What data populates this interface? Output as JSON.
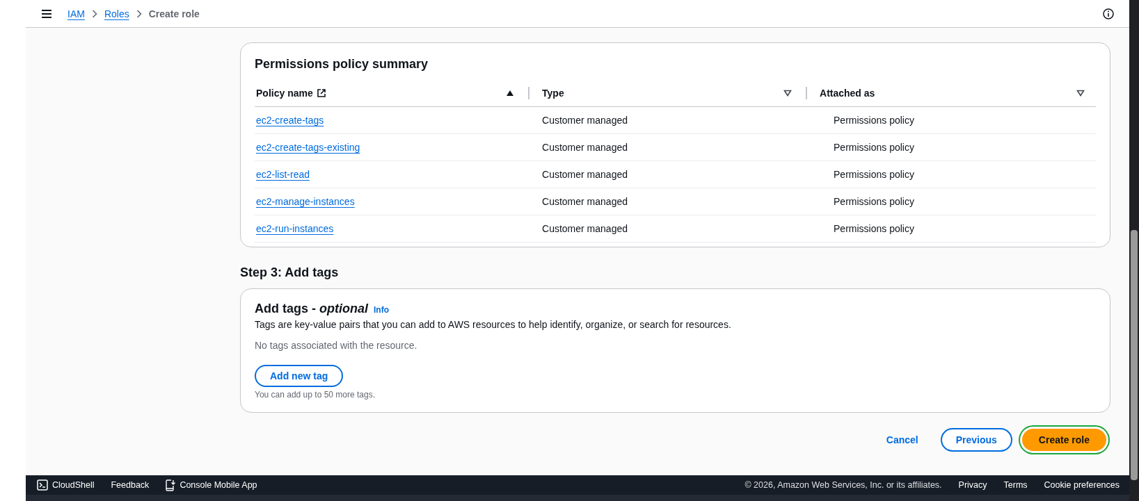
{
  "breadcrumbs": [
    {
      "label": "IAM",
      "kind": "link"
    },
    {
      "label": "Roles",
      "kind": "link"
    },
    {
      "label": "Create role",
      "kind": "current"
    }
  ],
  "policy_summary": {
    "title": "Permissions policy summary",
    "columns": [
      {
        "label": "Policy name",
        "sorted": true,
        "external_link": true
      },
      {
        "label": "Type",
        "sorted": false
      },
      {
        "label": "Attached as",
        "sorted": false
      }
    ],
    "rows": [
      {
        "policy_name": "ec2-create-tags",
        "type": "Customer managed",
        "attached_as": "Permissions policy"
      },
      {
        "policy_name": "ec2-create-tags-existing",
        "type": "Customer managed",
        "attached_as": "Permissions policy"
      },
      {
        "policy_name": "ec2-list-read",
        "type": "Customer managed",
        "attached_as": "Permissions policy"
      },
      {
        "policy_name": "ec2-manage-instances",
        "type": "Customer managed",
        "attached_as": "Permissions policy"
      },
      {
        "policy_name": "ec2-run-instances",
        "type": "Customer managed",
        "attached_as": "Permissions policy"
      }
    ]
  },
  "tags_step": {
    "heading": "Step 3: Add tags",
    "title": "Add tags - *optional*",
    "info": "Info",
    "description": "Tags are key-value pairs that you can add to AWS resources to help identify, organize, or search for resources.",
    "empty_message": "No tags associated with the resource.",
    "add_button": "Add new tag",
    "limit_note": "You can add up to 50 more tags."
  },
  "actions": [
    {
      "label": "Cancel",
      "kind": "link"
    },
    {
      "label": "Previous",
      "kind": "secondary"
    },
    {
      "label": "Create role",
      "kind": "primary",
      "highlighted": true
    }
  ],
  "footer": {
    "items": [
      {
        "label": "CloudShell",
        "kind": "terminal"
      },
      {
        "label": "Feedback",
        "kind": "text"
      },
      {
        "label": "Console Mobile App",
        "kind": "phone"
      }
    ],
    "copyright": "© 2026, Amazon Web Services, Inc. or its affiliates.",
    "links": [
      "Privacy",
      "Terms",
      "Cookie preferences"
    ]
  }
}
